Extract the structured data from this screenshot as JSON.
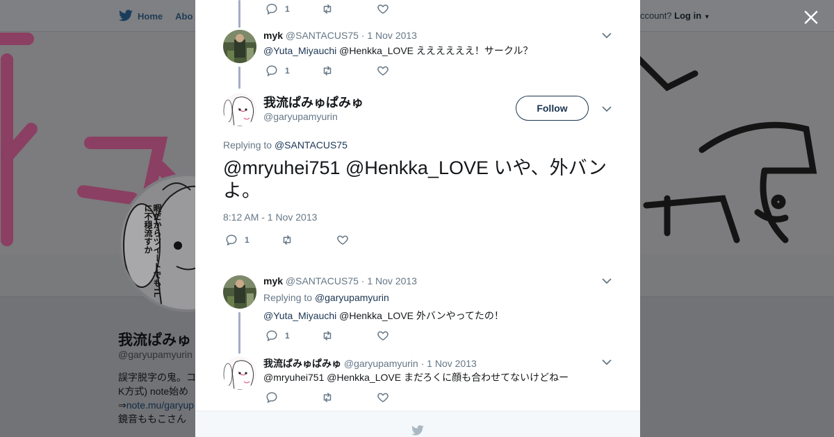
{
  "background": {
    "nav": {
      "home_label": "Home",
      "about_label": "Abo",
      "account_prompt": "ccount?",
      "login_label": "Log in"
    },
    "profile": {
      "name": "我流ぱみゅ",
      "handle": "@garyupamyurin",
      "bio_line1": "誤字脱字の鬼。コ",
      "bio_line2": "K方式) note始め",
      "bio_line3_prefix": "⇒",
      "bio_line3_link": "note.mu/garyup",
      "bio_line4": "鏡音ももこさん",
      "avatar_text": "暇だからツイートでもTLに不穏流すか"
    }
  },
  "close_label": "×",
  "thread": {
    "top_actions": {
      "reply_count": "1"
    },
    "reply1": {
      "name": "myk",
      "handle": "@SANTACUS75",
      "dot": "·",
      "date": "1 Nov 2013",
      "mention1": "@Yuta_Miyauchi",
      "text": " @Henkka_LOVE ええええええ！サークル？",
      "reply_count": "1"
    },
    "main": {
      "name": "我流ぱみゅぱみゅ",
      "handle": "@garyupamyurin",
      "follow_label": "Follow",
      "replying_prefix": "Replying to ",
      "replying_to": "@SANTACUS75",
      "text": "@mryuhei751 @Henkka_LOVE いや、外バンよ。",
      "timestamp": "8:12 AM - 1 Nov 2013",
      "reply_count": "1"
    },
    "reply2": {
      "name": "myk",
      "handle": "@SANTACUS75",
      "dot": "·",
      "date": "1 Nov 2013",
      "replying_prefix": "Replying to ",
      "replying_to": "@garyupamyurin",
      "mention1": "@Yuta_Miyauchi",
      "text": " @Henkka_LOVE 外バンやってたの！",
      "reply_count": "1"
    },
    "reply3": {
      "name": "我流ぱみゅぱみゅ",
      "handle": "@garyupamyurin",
      "dot": "·",
      "date": "1 Nov 2013",
      "text": "@mryuhei751 @Henkka_LOVE まだろくに顔も合わせてないけどねー"
    }
  },
  "colors": {
    "accent": "#1a3452",
    "muted": "#657786",
    "thread_line": "#a3acc6",
    "banner_pink": "#c23a78"
  },
  "icons": [
    "twitter-bird-icon",
    "close-icon",
    "reply-icon",
    "retweet-icon",
    "like-icon",
    "chevron-down-icon"
  ]
}
